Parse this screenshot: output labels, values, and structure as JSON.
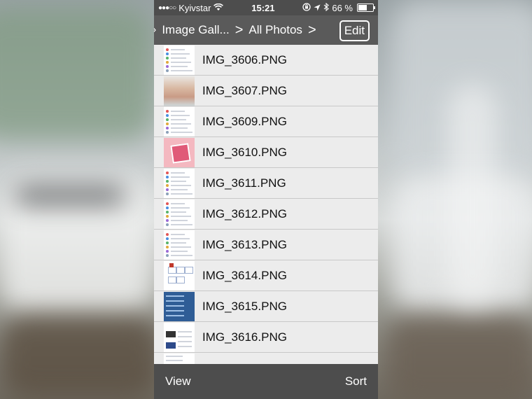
{
  "status_bar": {
    "signal": "●●●○○",
    "carrier": "Kyivstar",
    "time": "15:21",
    "battery": "66 %",
    "battery_level": 0.66
  },
  "nav": {
    "back_chevron": "›",
    "crumbs": [
      "Image Gall...",
      "All Photos"
    ],
    "separator": ">",
    "edit_label": "Edit"
  },
  "files": [
    {
      "name": "IMG_3606.PNG",
      "thumb": "list"
    },
    {
      "name": "IMG_3607.PNG",
      "thumb": "photo"
    },
    {
      "name": "IMG_3609.PNG",
      "thumb": "list"
    },
    {
      "name": "IMG_3610.PNG",
      "thumb": "pink"
    },
    {
      "name": "IMG_3611.PNG",
      "thumb": "list"
    },
    {
      "name": "IMG_3612.PNG",
      "thumb": "list"
    },
    {
      "name": "IMG_3613.PNG",
      "thumb": "list"
    },
    {
      "name": "IMG_3614.PNG",
      "thumb": "diagram"
    },
    {
      "name": "IMG_3615.PNG",
      "thumb": "blue"
    },
    {
      "name": "IMG_3616.PNG",
      "thumb": "news"
    }
  ],
  "toolbar": {
    "view_label": "View",
    "sort_label": "Sort"
  }
}
